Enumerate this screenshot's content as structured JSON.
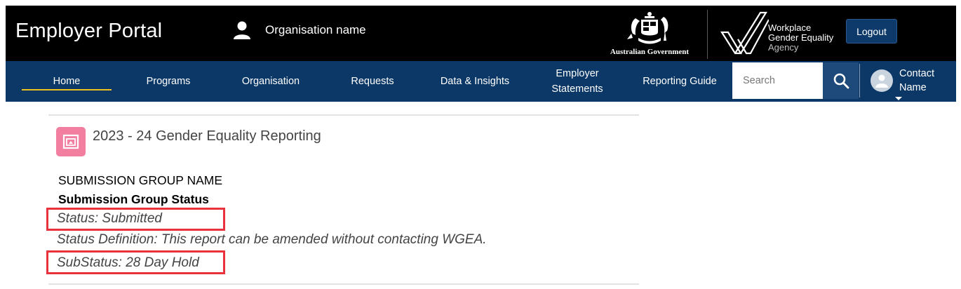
{
  "header": {
    "brand": "Employer Portal",
    "organisation_name": "Organisation name",
    "gov_label": "Australian Government",
    "agency_lines": [
      "Workplace",
      "Gender Equality",
      "Agency"
    ],
    "logout_label": "Logout"
  },
  "nav": {
    "items": [
      {
        "label": "Home",
        "active": true
      },
      {
        "label": "Programs"
      },
      {
        "label": "Organisation"
      },
      {
        "label": "Requests"
      },
      {
        "label": "Data & Insights"
      },
      {
        "label": "Employer Statements"
      },
      {
        "label": "Reporting Guide"
      }
    ],
    "search_placeholder": "Search",
    "contact_name": "Contact Name"
  },
  "content": {
    "title": "2023 - 24 Gender Equality Reporting",
    "group_name": "SUBMISSION GROUP NAME",
    "group_status_heading": "Submission Group Status",
    "status": "Status: Submitted",
    "status_definition": "Status Definition: This report can be amended without contacting WGEA.",
    "substatus": "SubStatus: 28 Day Hold"
  },
  "colors": {
    "header_bg": "#000000",
    "nav_bg": "#0b3866",
    "active_underline": "#f0c020",
    "card_icon": "#f27fa0",
    "highlight_box": "#e8323c"
  }
}
